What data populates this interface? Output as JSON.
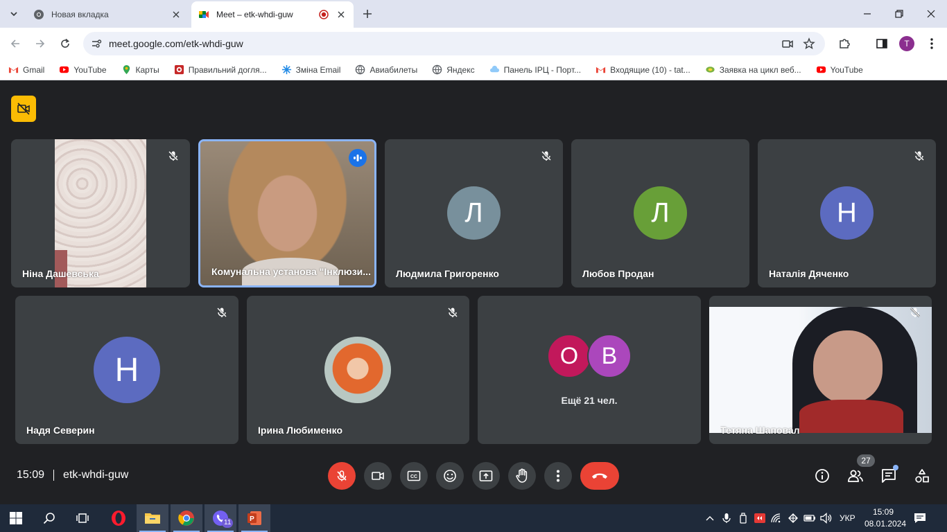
{
  "browser": {
    "tabs": [
      {
        "title": "Новая вкладка",
        "active": false
      },
      {
        "title": "Meet – etk-whdi-guw",
        "active": true
      }
    ],
    "url": "meet.google.com/etk-whdi-guw",
    "profile_initial": "T",
    "bookmarks": [
      {
        "label": "Gmail",
        "icon": "gmail-icon"
      },
      {
        "label": "YouTube",
        "icon": "youtube-icon"
      },
      {
        "label": "Карты",
        "icon": "maps-icon"
      },
      {
        "label": "Правильний догля...",
        "icon": "site-icon"
      },
      {
        "label": "Зміна Email",
        "icon": "snowflake-icon"
      },
      {
        "label": "Авиабилеты",
        "icon": "globe-icon"
      },
      {
        "label": "Яндекс",
        "icon": "globe-icon"
      },
      {
        "label": "Панель ІРЦ - Порт...",
        "icon": "cloud-icon"
      },
      {
        "label": "Входящие (10) - tat...",
        "icon": "gmail-icon"
      },
      {
        "label": "Заявка на цикл веб...",
        "icon": "leaf-icon"
      },
      {
        "label": "YouTube",
        "icon": "youtube-icon"
      }
    ]
  },
  "meet": {
    "participants_row1": [
      {
        "name": "Ніна Дашевська",
        "type": "video",
        "muted": true
      },
      {
        "name": "Комунальна установа \"Інклюзи...",
        "type": "video",
        "speaking": true
      },
      {
        "name": "Людмила Григоренко",
        "type": "avatar",
        "initial": "Л",
        "color": "#78909c",
        "muted": true
      },
      {
        "name": "Любов Продан",
        "type": "avatar",
        "initial": "Л",
        "color": "#689f38"
      },
      {
        "name": "Наталія Дяченко",
        "type": "avatar",
        "initial": "Н",
        "color": "#5c6bc0",
        "muted": true
      }
    ],
    "participants_row2": [
      {
        "name": "Надя Северин",
        "type": "avatar",
        "initial": "Н",
        "color": "#5c6bc0",
        "muted": true
      },
      {
        "name": "Ірина Любименко",
        "type": "photo",
        "muted": true
      },
      {
        "name": "Тетяна Шаповал",
        "type": "video",
        "muted": true
      }
    ],
    "more": {
      "avatars": [
        {
          "initial": "О",
          "color": "#c2185b"
        },
        {
          "initial": "В",
          "color": "#ab47bc"
        }
      ],
      "label": "Ещё 21 чел."
    },
    "time": "15:09",
    "meeting_code": "etk-whdi-guw",
    "people_count": "27"
  },
  "taskbar": {
    "lang": "УКР",
    "time": "15:09",
    "date": "08.01.2024",
    "viber_badge": "11"
  },
  "colors": {
    "meet_bg": "#202124",
    "tile_bg": "#3c4043",
    "end_call": "#ea4335",
    "accent": "#8ab4f8"
  }
}
